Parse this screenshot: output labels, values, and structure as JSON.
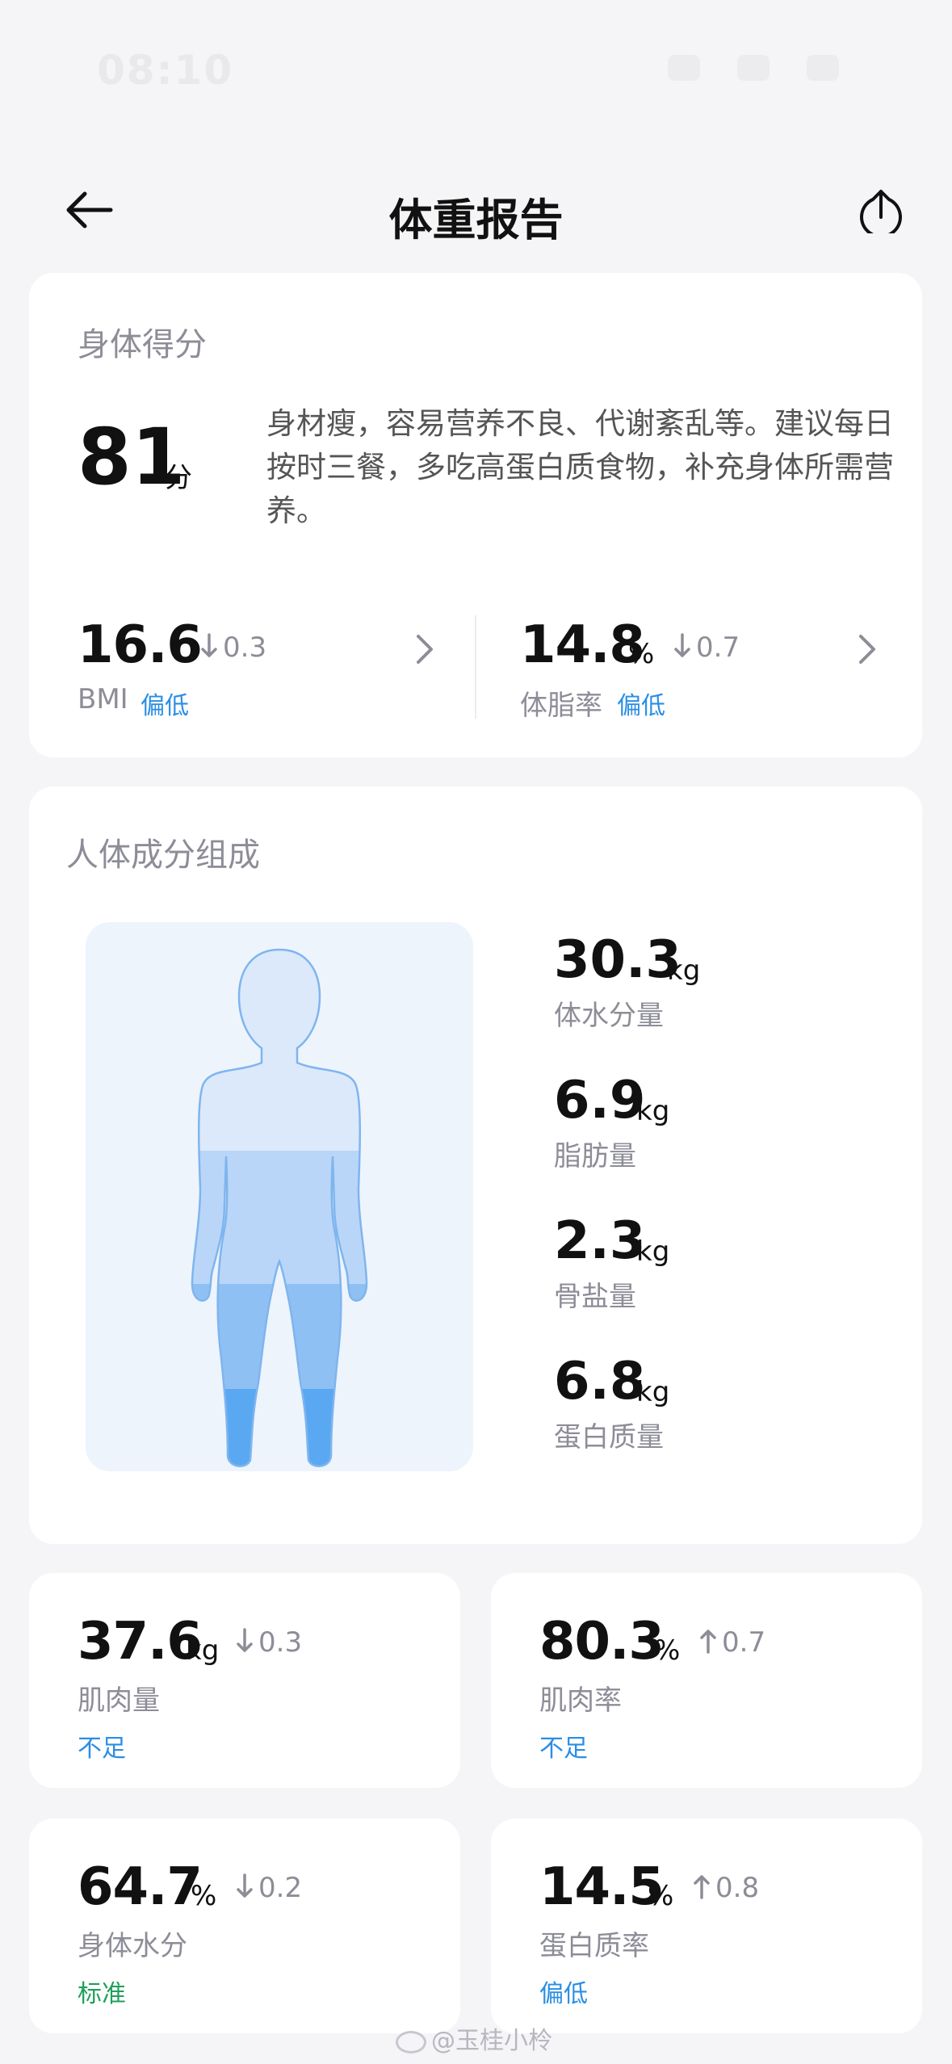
{
  "status_bar": {
    "time": "08:10"
  },
  "header": {
    "title": "体重报告",
    "back_icon": "arrow-left-icon",
    "share_icon": "share-icon"
  },
  "score_card": {
    "title": "身体得分",
    "score": "81",
    "score_unit": "分",
    "description": "身材瘦，容易营养不良、代谢紊乱等。建议每日按时三餐，多吃高蛋白质食物，补充身体所需营养。",
    "bmi": {
      "value": "16.6",
      "delta": "0.3",
      "direction": "down",
      "label": "BMI",
      "status": "偏低"
    },
    "body_fat": {
      "value": "14.8",
      "unit": "%",
      "delta": "0.7",
      "direction": "down",
      "label": "体脂率",
      "status": "偏低"
    }
  },
  "composition_card": {
    "title": "人体成分组成",
    "items": [
      {
        "value": "30.3",
        "unit": "kg",
        "label": "体水分量"
      },
      {
        "value": "6.9",
        "unit": "kg",
        "label": "脂肪量"
      },
      {
        "value": "2.3",
        "unit": "kg",
        "label": "骨盐量"
      },
      {
        "value": "6.8",
        "unit": "kg",
        "label": "蛋白质量"
      }
    ],
    "colors": {
      "panel": "#eef4fc",
      "upper": "#dce9fb",
      "middle": "#b9d6f8",
      "lower": "#8fc0f4",
      "feet": "#5aa8f2"
    }
  },
  "metric_cards": [
    {
      "value": "37.6",
      "unit": "kg",
      "delta": "0.3",
      "direction": "down",
      "label": "肌肉量",
      "status": "不足",
      "status_color": "#2a8ee4"
    },
    {
      "value": "80.3",
      "unit": "%",
      "delta": "0.7",
      "direction": "up",
      "label": "肌肉率",
      "status": "不足",
      "status_color": "#2a8ee4"
    },
    {
      "value": "64.7",
      "unit": "%",
      "delta": "0.2",
      "direction": "down",
      "label": "身体水分",
      "status": "标准",
      "status_color": "#1ea05a"
    },
    {
      "value": "14.5",
      "unit": "%",
      "delta": "0.8",
      "direction": "up",
      "label": "蛋白质率",
      "status": "偏低",
      "status_color": "#2a8ee4"
    }
  ],
  "watermark": "@玉桂小柃"
}
